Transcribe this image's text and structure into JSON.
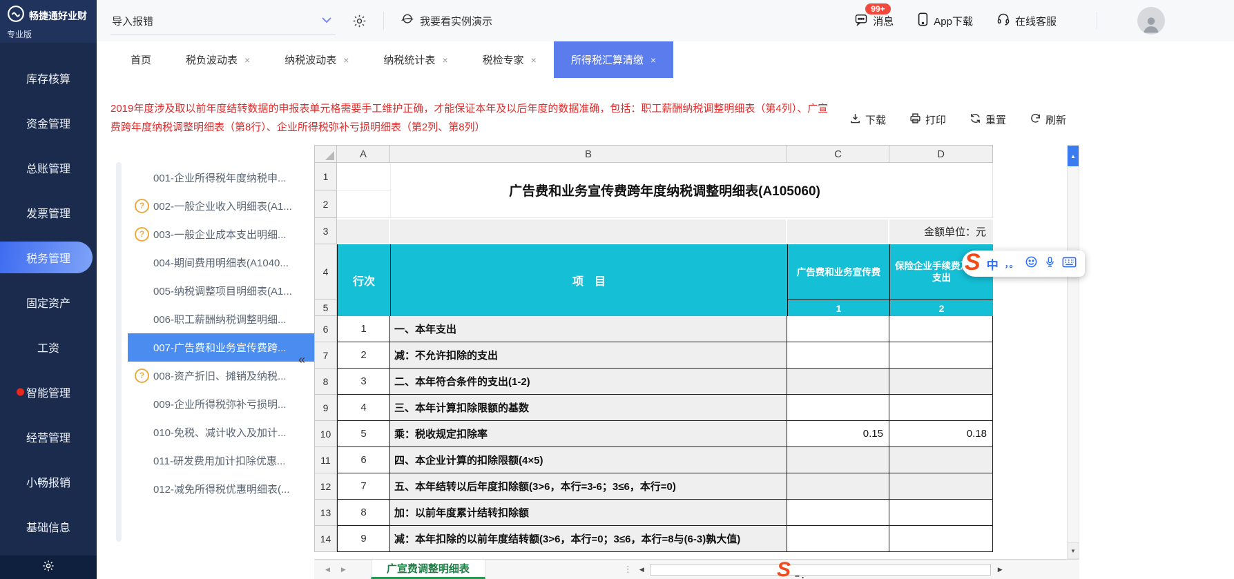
{
  "brand": {
    "name": "畅捷通好业财",
    "edition": "专业版"
  },
  "topbar": {
    "import_error": "导入报错",
    "demo": "我要看实例演示",
    "messages": "消息",
    "messages_badge": "99+",
    "app_download": "App下载",
    "online_support": "在线客服"
  },
  "tabs": [
    {
      "label": "首页",
      "closable": false,
      "active": false
    },
    {
      "label": "税负波动表",
      "closable": true,
      "active": false
    },
    {
      "label": "纳税波动表",
      "closable": true,
      "active": false
    },
    {
      "label": "纳税统计表",
      "closable": true,
      "active": false
    },
    {
      "label": "税检专家",
      "closable": true,
      "active": false
    },
    {
      "label": "所得税汇算清缴",
      "closable": true,
      "active": true
    }
  ],
  "sidebar": {
    "items": [
      {
        "label": "库存核算",
        "active": false,
        "dot": false
      },
      {
        "label": "资金管理",
        "active": false,
        "dot": false
      },
      {
        "label": "总账管理",
        "active": false,
        "dot": false
      },
      {
        "label": "发票管理",
        "active": false,
        "dot": false
      },
      {
        "label": "税务管理",
        "active": true,
        "dot": false
      },
      {
        "label": "固定资产",
        "active": false,
        "dot": false
      },
      {
        "label": "工资",
        "active": false,
        "dot": false
      },
      {
        "label": "智能管理",
        "active": false,
        "dot": true
      },
      {
        "label": "经营管理",
        "active": false,
        "dot": false
      },
      {
        "label": "小畅报销",
        "active": false,
        "dot": false
      },
      {
        "label": "基础信息",
        "active": false,
        "dot": false
      }
    ]
  },
  "warning": {
    "text": "2019年度涉及取以前年度结转数据的申报表单元格需要手工维护正确，才能保证本年及以后年度的数据准确，包括：职工薪酬纳税调整明细表（第4列）、广宣费跨年度纳税调整明细表（第8行）、企业所得税弥补亏损明细表（第2列、第8列）"
  },
  "toolbar": {
    "download": "下载",
    "print": "打印",
    "reset": "重置",
    "refresh": "刷新"
  },
  "report_list": {
    "items": [
      {
        "label": "001-企业所得税年度纳税申...",
        "help": false,
        "selected": false
      },
      {
        "label": "002-一般企业收入明细表(A1...",
        "help": true,
        "selected": false
      },
      {
        "label": "003-一般企业成本支出明细...",
        "help": true,
        "selected": false
      },
      {
        "label": "004-期间费用明细表(A1040...",
        "help": false,
        "selected": false
      },
      {
        "label": "005-纳税调整项目明细表(A1...",
        "help": false,
        "selected": false
      },
      {
        "label": "006-职工薪酬纳税调整明细...",
        "help": false,
        "selected": false
      },
      {
        "label": "007-广告费和业务宣传费跨...",
        "help": false,
        "selected": true
      },
      {
        "label": "008-资产折旧、摊销及纳税...",
        "help": true,
        "selected": false
      },
      {
        "label": "009-企业所得税弥补亏损明...",
        "help": false,
        "selected": false
      },
      {
        "label": "010-免税、减计收入及加计...",
        "help": false,
        "selected": false
      },
      {
        "label": "011-研发费用加计扣除优惠...",
        "help": false,
        "selected": false
      },
      {
        "label": "012-减免所得税优惠明细表(...",
        "help": false,
        "selected": false
      }
    ]
  },
  "spreadsheet": {
    "column_letters": [
      "A",
      "B",
      "C",
      "D"
    ],
    "title": "广告费和业务宣传费跨年度纳税调整明细表(A105060)",
    "unit_note": "金额单位：元",
    "header": {
      "line_col": "行次",
      "item_col": "项　目",
      "col1": "广告费和业务宣传费",
      "col2": "保险企业手续费及佣金支出",
      "sub_numbers": [
        "1",
        "2"
      ]
    },
    "rows": [
      {
        "line": "1",
        "item": "一、本年支出",
        "c": "",
        "d": "",
        "computed": false
      },
      {
        "line": "2",
        "item": "减：不允许扣除的支出",
        "c": "",
        "d": "",
        "computed": false
      },
      {
        "line": "3",
        "item": "二、本年符合条件的支出(1-2)",
        "c": "",
        "d": "",
        "computed": true
      },
      {
        "line": "4",
        "item": "三、本年计算扣除限额的基数",
        "c": "",
        "d": "",
        "computed": false
      },
      {
        "line": "5",
        "item": "乘：税收规定扣除率",
        "c": "0.15",
        "d": "0.18",
        "computed": false
      },
      {
        "line": "6",
        "item": "四、本企业计算的扣除限额(4×5)",
        "c": "",
        "d": "",
        "computed": true
      },
      {
        "line": "7",
        "item": "五、本年结转以后年度扣除额(3>6，本行=3-6；3≤6，本行=0)",
        "c": "",
        "d": "",
        "computed": true
      },
      {
        "line": "8",
        "item": "加：以前年度累计结转扣除额",
        "c": "",
        "d": "",
        "computed": false
      },
      {
        "line": "9",
        "item": "减：本年扣除的以前年度结转额(3>6，本行=0；3≤6，本行=8与(6-3)孰大值)",
        "c": "",
        "d": "",
        "computed": false
      }
    ],
    "first_data_row_number": 6,
    "sheet_tab": "广宣费调整明细表"
  },
  "ime": {
    "logo": "S",
    "mode": "中",
    "punct": "，。"
  },
  "icons": {
    "up": "▲",
    "down": "▼",
    "prev": "◀",
    "next": "▶",
    "dots": "⋮",
    "collapse": "«",
    "close": "×",
    "question": "?"
  },
  "colors": {
    "sidebar_navy": "#1a2b4e",
    "active_tab_blue": "#5b7cec",
    "selected_item_blue": "#4a8cf0",
    "cyan_header": "#15bfd6",
    "warning_red": "#e02b2b",
    "sheet_tab_green": "#1e7e45",
    "badge_red": "#f5483c",
    "sogou_orange": "#f34a1d"
  }
}
